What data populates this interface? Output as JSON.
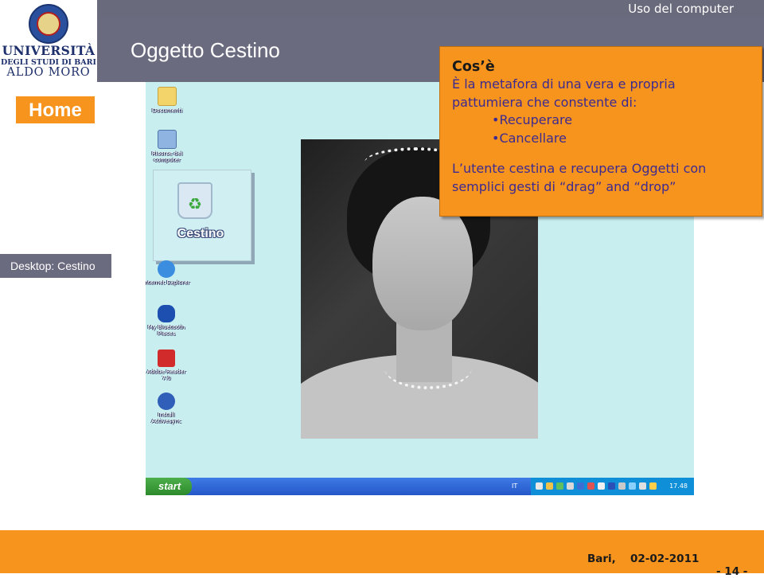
{
  "header": {
    "university": {
      "line1": "UNIVERSITÀ",
      "line2": "DEGLI STUDI DI BARI",
      "line3": "ALDO MORO"
    },
    "section": "Uso del computer",
    "title": "Oggetto Cestino"
  },
  "nav": {
    "home": "Home",
    "current": "Desktop: Cestino"
  },
  "desktop": {
    "icons": [
      {
        "name": "documenti",
        "label": "Documenti",
        "icon": "folder-icon"
      },
      {
        "name": "risorse",
        "label": "Risorse del computer",
        "icon": "computer-icon"
      },
      {
        "name": "ie",
        "label": "Internet Explorer",
        "icon": "internet-explorer-icon"
      },
      {
        "name": "bluetooth",
        "label": "My Bluetooth Places",
        "icon": "bluetooth-icon"
      },
      {
        "name": "adobe",
        "label": "Adobe Reader 7.0",
        "icon": "pdf-icon"
      },
      {
        "name": "install",
        "label": "Install Activesync",
        "icon": "install-icon"
      }
    ],
    "recycle_bin_label": "Cestino",
    "start_label": "start",
    "language": "IT",
    "clock": "17.48"
  },
  "callout": {
    "title": "Cos’è",
    "line1": "È la metafora di una vera e propria",
    "line2": "pattumiera che constente di:",
    "bullet1": "•Recuperare",
    "bullet2": "•Cancellare",
    "line3": "L’utente cestina e recupera Oggetti con",
    "line4": "semplici gesti di “drag” and “drop”"
  },
  "footer": {
    "place": "Bari,",
    "date": "02-02-2011",
    "page": "- 14 -"
  },
  "colors": {
    "accent_orange": "#f7941d",
    "header_gray": "#6b6b80",
    "desktop_bg": "#c9eef0",
    "university_blue": "#1d2f6b"
  }
}
